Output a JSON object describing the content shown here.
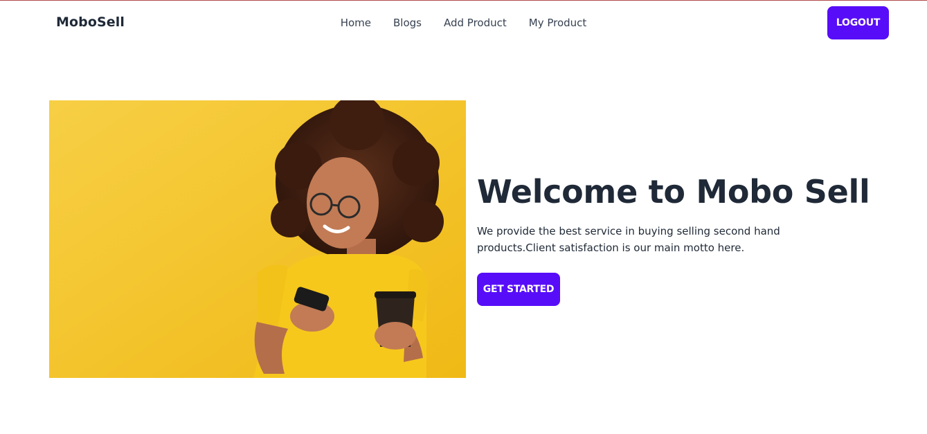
{
  "navbar": {
    "brand": "MoboSell",
    "links": [
      "Home",
      "Blogs",
      "Add Product",
      "My Product"
    ],
    "logout_label": "LOGOUT"
  },
  "hero": {
    "title": "Welcome to Mobo Sell",
    "description": "We provide the best service in buying selling second hand products.Client satisfaction is our main motto here.",
    "cta_label": "GET STARTED"
  },
  "colors": {
    "accent": "#570df8",
    "hero_background": "#f5c73a",
    "text": "#1f2937"
  }
}
